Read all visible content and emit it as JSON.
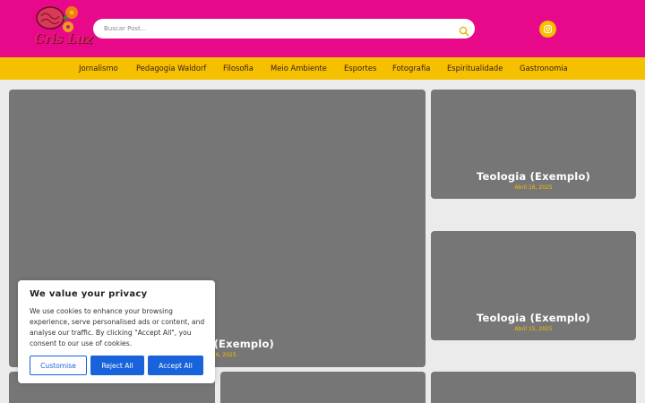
{
  "header": {
    "logo_text": "Cris Luz",
    "search": {
      "placeholder": "Buscar Post..."
    }
  },
  "icons": {
    "search": "search-icon",
    "instagram": "instagram-icon"
  },
  "colors": {
    "header_bg": "#e8088a",
    "nav_bg": "#f5c000",
    "accent": "#f5c000",
    "card_bg": "#767676",
    "cookie_button": "#1863dc"
  },
  "nav": {
    "items": [
      {
        "label": "Jornalismo"
      },
      {
        "label": "Pedagogia Waldorf"
      },
      {
        "label": "Filosofia"
      },
      {
        "label": "Meio Ambiente"
      },
      {
        "label": "Esportes"
      },
      {
        "label": "Fotografia"
      },
      {
        "label": "Espiritualidade"
      },
      {
        "label": "Gastronomia"
      }
    ]
  },
  "posts": [
    {
      "title": "Teologia (Exemplo)",
      "date": "Abril 16, 2025"
    },
    {
      "title": "Teologia (Exemplo)",
      "date": "Abril 15, 2025"
    },
    {
      "title": "Teologia (Exemplo)",
      "date": "Abril 16, 2025"
    }
  ],
  "cookie": {
    "title": "We value your privacy",
    "text": "We use cookies to enhance your browsing experience, serve personalised ads or content, and analyse our traffic. By clicking \"Accept All\", you consent to our use of cookies.",
    "customise": "Customise",
    "reject": "Reject All",
    "accept": "Accept All"
  }
}
